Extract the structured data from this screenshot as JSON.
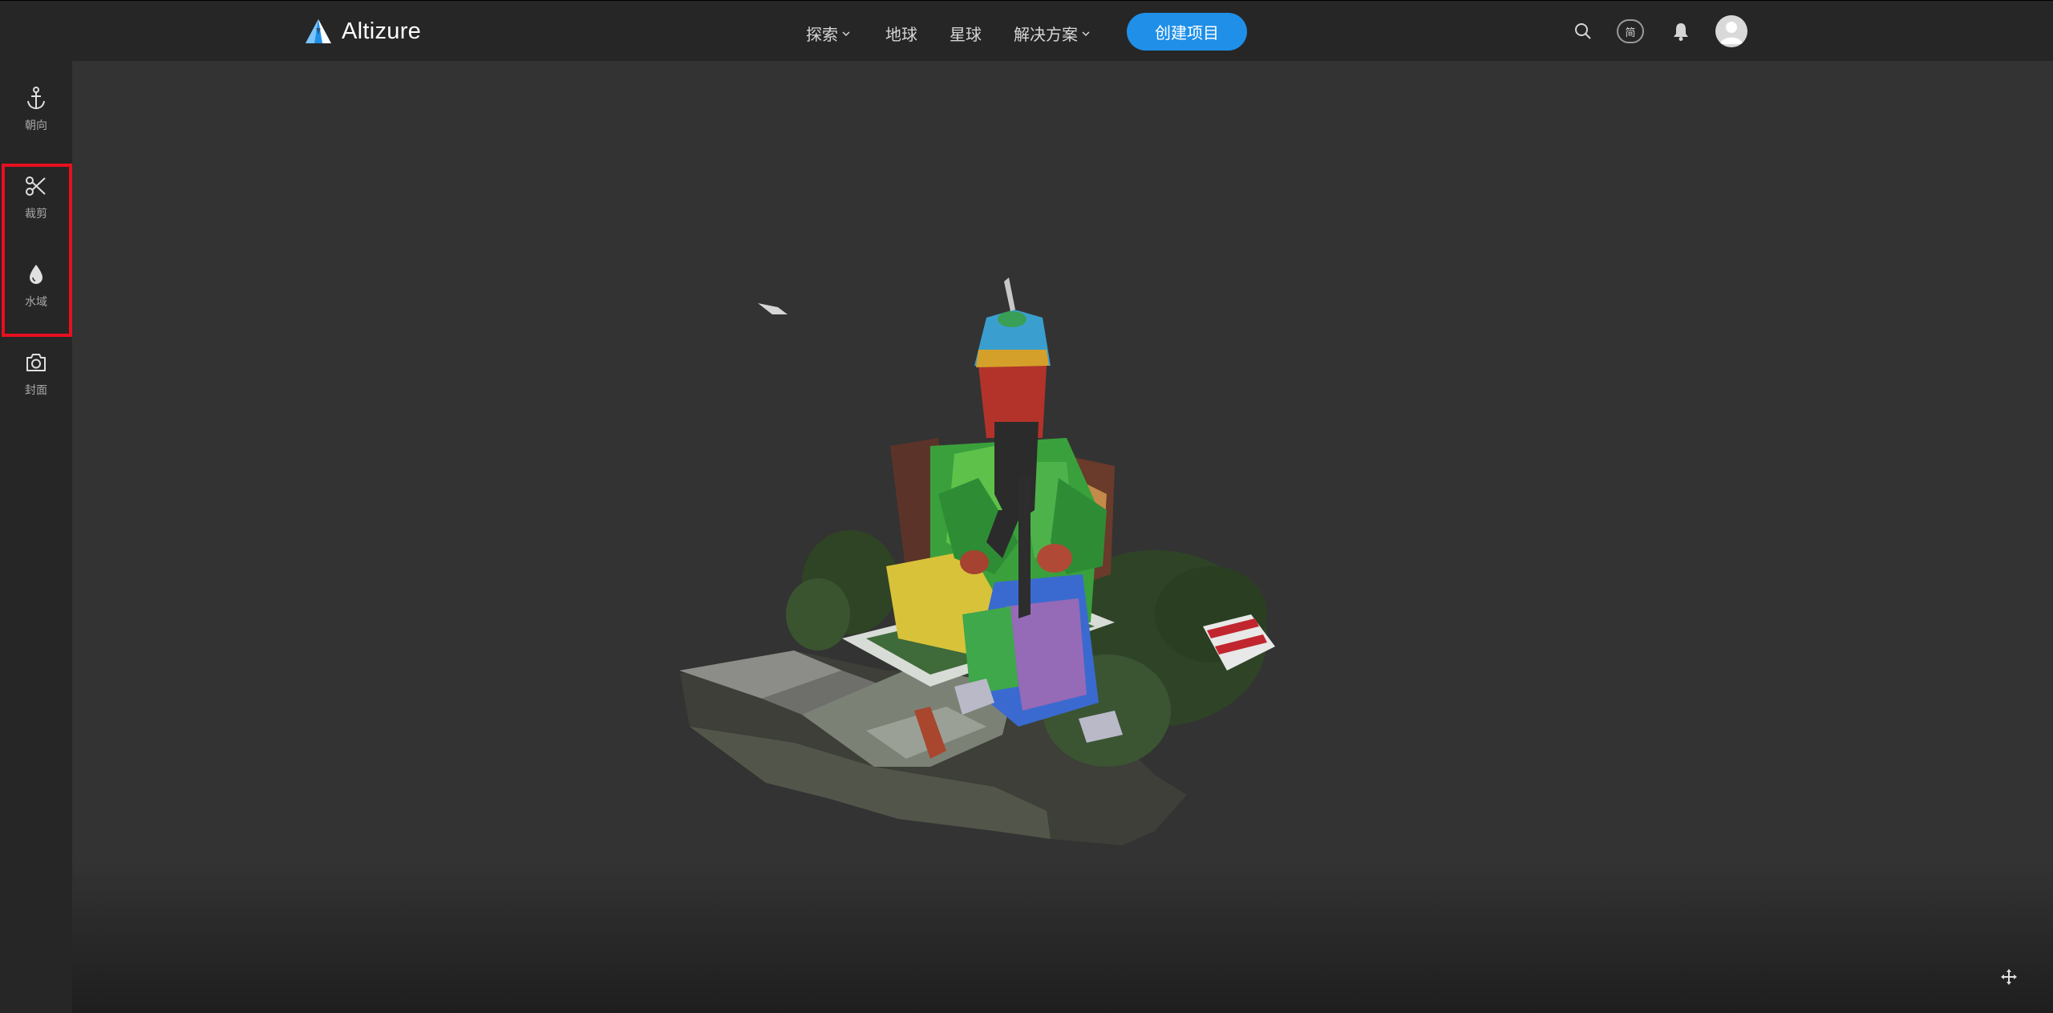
{
  "app": {
    "brand": "Altizure"
  },
  "nav": {
    "explore": "探索",
    "earth": "地球",
    "planet": "星球",
    "solutions": "解决方案",
    "create_project": "创建项目"
  },
  "header_icons": {
    "search": "search-icon",
    "language": "简",
    "bell": "bell-icon",
    "avatar": "user-avatar"
  },
  "sidebar": {
    "items": [
      {
        "icon": "anchor-icon",
        "label": "朝向"
      },
      {
        "icon": "scissors-icon",
        "label": "裁剪"
      },
      {
        "icon": "water-drop-icon",
        "label": "水域"
      },
      {
        "icon": "camera-icon",
        "label": "封面"
      }
    ]
  },
  "viewport": {
    "content": "3D model viewer"
  },
  "colors": {
    "topbar": "#262626",
    "sidebar": "#262626",
    "viewport": "#333333",
    "accent": "#1f8fe8",
    "highlight": "#e8101f"
  }
}
